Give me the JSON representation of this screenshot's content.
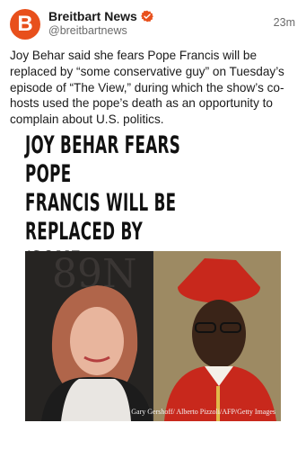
{
  "post": {
    "author": "Breitbart News",
    "handle": "@breitbartnews",
    "time": "23m",
    "avatar_letter": "B",
    "body": "Joy Behar said she fears Pope Francis will be replaced by “some conservative guy” on Tuesday’s episode of “The View,” during which the show’s co-hosts used the pope’s death as an opportunity to complain about U.S. politics."
  },
  "card": {
    "headline": "JOY BEHAR FEARS POPE\nFRANCIS WILL BE\nREPLACED BY ‘SOME\nCONSERVATIVE GUY’",
    "photo_credit": "Gary Gershoff/ Alberto Pizzoli/AFP/Getty Images"
  },
  "colors": {
    "brand": "#e8501c",
    "verified": "#e8501c"
  },
  "icons": {
    "verified": "verified-badge-icon"
  }
}
